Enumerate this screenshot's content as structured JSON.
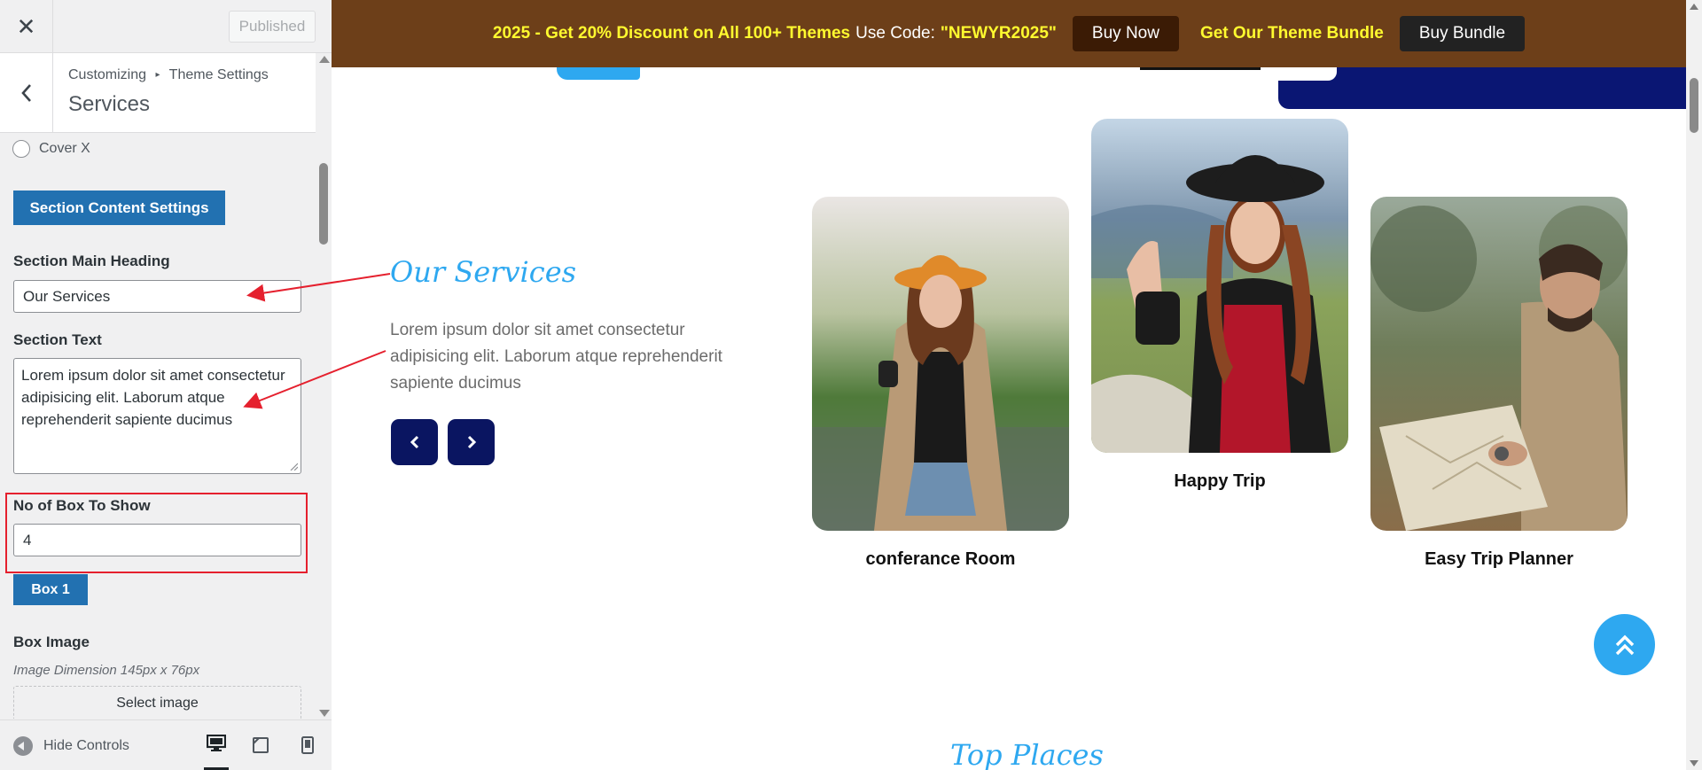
{
  "panel": {
    "close_label": "✕",
    "published_label": "Published",
    "breadcrumb": {
      "root": "Customizing",
      "separator": "▸",
      "parent": "Theme Settings"
    },
    "title": "Services",
    "radio_option": "Cover X",
    "section_content_button": "Section Content Settings",
    "heading_label": "Section Main Heading",
    "heading_value": "Our Services",
    "text_label": "Section Text",
    "text_value": "Lorem ipsum dolor sit amet consectetur adipisicing elit. Laborum atque reprehenderit sapiente ducimus",
    "box_count_label": "No of Box To Show",
    "box_count_value": "4",
    "box1_button": "Box 1",
    "box_image_label": "Box Image",
    "image_dimension_note": "Image Dimension 145px x 76px",
    "select_image_label": "Select image",
    "hide_controls_label": "Hide Controls"
  },
  "preview": {
    "promo": {
      "offer": "2025 - Get 20% Discount on All 100+ Themes",
      "use_code": "Use Code:",
      "code": "\"NEWYR2025\"",
      "buy_now": "Buy Now",
      "bundle_text": "Get Our Theme Bundle",
      "buy_bundle": "Buy Bundle"
    },
    "services_heading": "Our Services",
    "services_text": "Lorem ipsum dolor sit amet consectetur adipisicing elit. Laborum atque reprehenderit sapiente ducimus",
    "cards": [
      {
        "title": "conferance Room"
      },
      {
        "title": "Happy Trip"
      },
      {
        "title": "Easy Trip Planner"
      }
    ],
    "next_section_heading": "Top Places"
  },
  "colors": {
    "wp_blue": "#2271b1",
    "promo_bg": "#6d3f19",
    "promo_yellow": "#fffa2f",
    "accent_blue": "#2ea8f0",
    "navy": "#0a1561",
    "highlight_red": "#e5202e"
  }
}
